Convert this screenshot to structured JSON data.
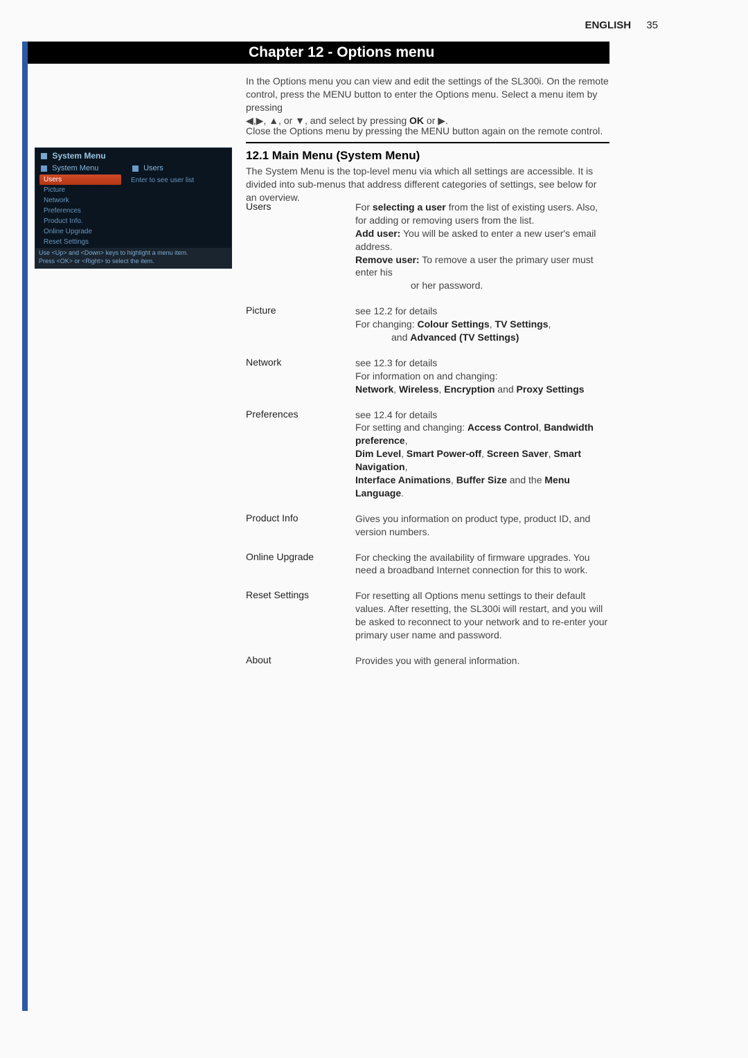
{
  "header": {
    "language": "ENGLISH",
    "pageNumber": "35"
  },
  "chapter": {
    "title": "Chapter 12 - Options menu"
  },
  "intro": {
    "line1": "In the Options menu you can view and edit the settings of the SL300i. On the remote control, press the MENU button to enter the Options menu. Select a menu item by pressing",
    "line2a": "◀,▶, ▲, or ▼, and select by pressing ",
    "line2b": "OK",
    "line2c": " or ▶.",
    "close": "Close the Options menu by pressing the MENU button again on the remote control."
  },
  "section": {
    "title": "12.1 Main Menu (System Menu)",
    "intro": "The System Menu is the top-level menu via which all settings are accessible. It is divided into sub-menus that address different categories of settings, see below for an overview."
  },
  "screenshot": {
    "title": "System Menu",
    "leftHeader": "System Menu",
    "rightHeader": "Users",
    "rightText": "Enter to see user list",
    "items": [
      "Users",
      "Picture",
      "Network",
      "Preferences",
      "Product Info.",
      "Online Upgrade",
      "Reset Settings"
    ],
    "footer1": "Use <Up> and <Down> keys to highlight a menu item.",
    "footer2": "Press <OK> or <Right> to select the item."
  },
  "entries": {
    "users": {
      "label": "Users",
      "desc1a": "For ",
      "desc1b": "selecting a user",
      "desc1c": " from the list of existing users. Also, for adding or removing users from the list.",
      "desc2a": "Add user:",
      "desc2b": " You will be asked to enter a new user's email address.",
      "desc3a": "Remove user:",
      "desc3b": " To remove a user the primary user must enter his",
      "desc3c": "or her password."
    },
    "picture": {
      "label": "Picture",
      "desc1": "see 12.2 for details",
      "desc2a": "For changing: ",
      "desc2b": "Colour Settings",
      "desc2c": ", ",
      "desc2d": "TV Settings",
      "desc2e": ",",
      "desc3a": "and ",
      "desc3b": "Advanced (TV Settings)"
    },
    "network": {
      "label": "Network",
      "desc1": "see 12.3 for details",
      "desc2": "For information on and changing:",
      "desc3a": "Network",
      "desc3b": ", ",
      "desc3c": "Wireless",
      "desc3d": ", ",
      "desc3e": "Encryption",
      "desc3f": " and ",
      "desc3g": "Proxy Settings"
    },
    "preferences": {
      "label": "Preferences",
      "desc1": "see 12.4 for details",
      "desc2a": "For setting and changing: ",
      "desc2b": "Access Control",
      "desc2c": ", ",
      "desc2d": "Bandwidth preference",
      "desc2e": ",",
      "desc3a": "Dim Level",
      "desc3b": ", ",
      "desc3c": "Smart Power-off",
      "desc3d": ", ",
      "desc3e": "Screen Saver",
      "desc3f": ", ",
      "desc3g": "Smart Navigation",
      "desc3h": ",",
      "desc4a": "Interface Animations",
      "desc4b": ", ",
      "desc4c": "Buffer Size",
      "desc4d": " and the ",
      "desc4e": "Menu Language",
      "desc4f": "."
    },
    "productInfo": {
      "label": "Product Info",
      "desc": "Gives you information on product type, product ID, and version numbers."
    },
    "onlineUpgrade": {
      "label": "Online Upgrade",
      "desc": "For checking the availability of firmware upgrades. You need a broadband Internet connection for this to work."
    },
    "resetSettings": {
      "label": "Reset Settings",
      "desc": "For resetting all Options menu settings to their default values. After resetting, the SL300i will restart, and you will be asked to reconnect to your network and to re-enter your primary user name and password."
    },
    "about": {
      "label": "About",
      "desc": "Provides you with general information."
    }
  }
}
